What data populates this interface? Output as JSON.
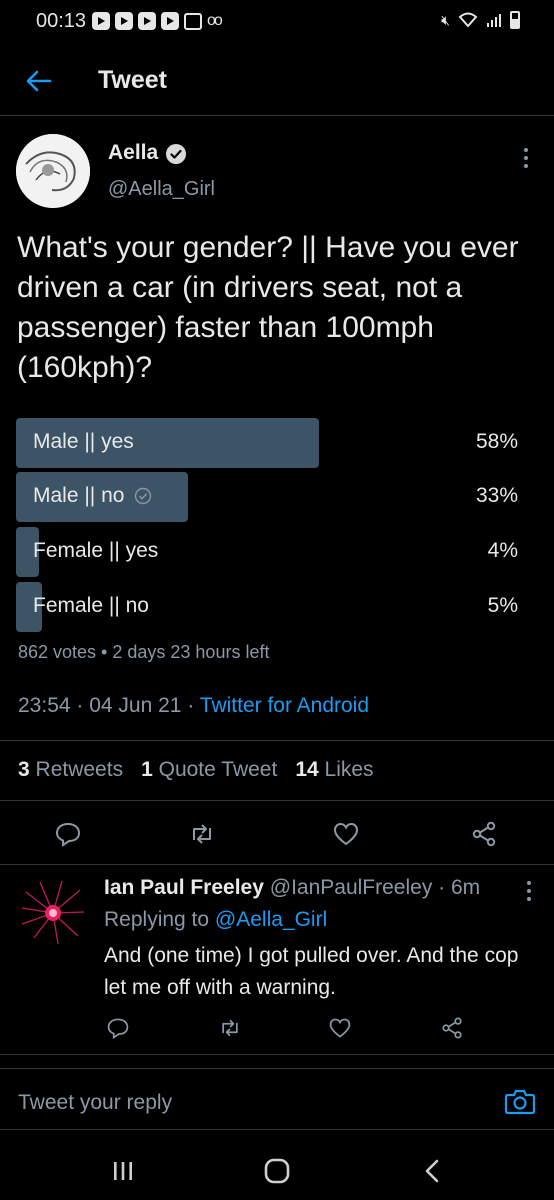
{
  "status_bar": {
    "time": "00:13",
    "left_icons": [
      "youtube-icon",
      "youtube-icon",
      "youtube-icon",
      "youtube-icon",
      "message-icon",
      "voicemail-icon"
    ],
    "right_icons": [
      "mute-icon",
      "wifi-icon",
      "signal-icon",
      "battery-icon"
    ]
  },
  "header": {
    "title": "Tweet",
    "back_icon": "arrow-left-icon"
  },
  "tweet": {
    "author_name": "Aella",
    "author_handle": "@Aella_Girl",
    "verified": true,
    "text": "What's your gender? || Have you ever driven a car (in drivers seat, not a passenger) faster than 100mph (160kph)?",
    "poll": {
      "options": [
        {
          "label": "Male || yes",
          "percent": "58%",
          "value": 58,
          "selected": false
        },
        {
          "label": "Male || no",
          "percent": "33%",
          "value": 33,
          "selected": true
        },
        {
          "label": "Female || yes",
          "percent": "4%",
          "value": 4,
          "selected": false
        },
        {
          "label": "Female || no",
          "percent": "5%",
          "value": 5,
          "selected": false
        }
      ],
      "summary": "862 votes • 2 days 23 hours left"
    },
    "time": "23:54",
    "sep1": " · ",
    "date": "04 Jun 21",
    "sep2": " · ",
    "source": "Twitter for Android",
    "stats": {
      "retweets_count": "3",
      "retweets_label": "Retweets",
      "quotes_count": "1",
      "quotes_label": "Quote Tweet",
      "likes_count": "14",
      "likes_label": "Likes"
    }
  },
  "reply": {
    "name": "Ian Paul Freeley",
    "handle_time": "@IanPaulFreeley · 6m",
    "replying_prefix": "Replying to",
    "replying_to": "@Aella_Girl",
    "text": "And (one time) I got pulled over. And the cop let me off with a warning."
  },
  "composer": {
    "placeholder": "Tweet your reply"
  },
  "colors": {
    "accent": "#1d9bf0",
    "poll_bar": "#3d5466",
    "background": "#000000",
    "muted": "#8b98a5"
  }
}
